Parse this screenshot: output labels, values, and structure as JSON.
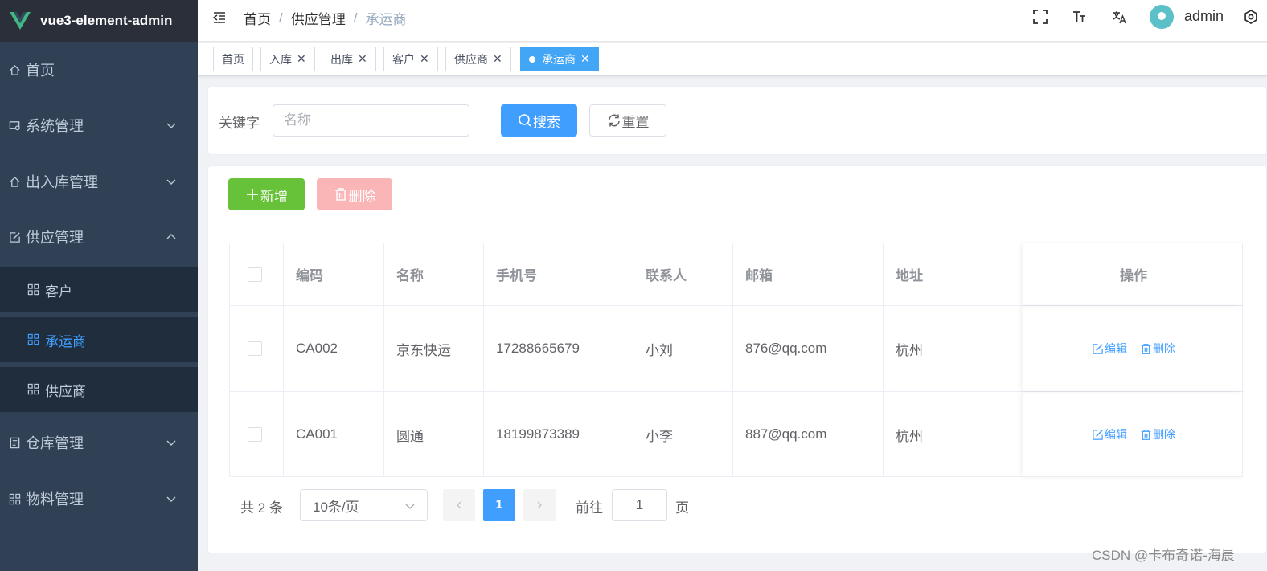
{
  "app": {
    "title": "vue3-element-admin"
  },
  "sidebar": {
    "items": [
      {
        "label": "首页",
        "icon": "home-icon"
      },
      {
        "label": "系统管理",
        "icon": "system-icon"
      },
      {
        "label": "出入库管理",
        "icon": "home-icon"
      },
      {
        "label": "供应管理",
        "icon": "edit-icon"
      },
      {
        "label": "仓库管理",
        "icon": "document-icon"
      },
      {
        "label": "物料管理",
        "icon": "grid-icon"
      }
    ],
    "sub_items": [
      {
        "label": "客户",
        "icon": "grid-icon"
      },
      {
        "label": "承运商",
        "icon": "grid-icon",
        "active": true
      },
      {
        "label": "供应商",
        "icon": "grid-icon"
      }
    ]
  },
  "navbar": {
    "breadcrumb": [
      "首页",
      "供应管理",
      "承运商"
    ],
    "username": "admin"
  },
  "tags": [
    {
      "label": "首页"
    },
    {
      "label": "入库"
    },
    {
      "label": "出库"
    },
    {
      "label": "客户"
    },
    {
      "label": "供应商"
    },
    {
      "label": "承运商",
      "active": true
    }
  ],
  "search": {
    "label": "关键字",
    "placeholder": "名称",
    "search_button": "搜索",
    "reset_button": "重置"
  },
  "toolbar": {
    "add_button": "新增",
    "delete_button": "删除"
  },
  "table": {
    "columns": [
      "编码",
      "名称",
      "手机号",
      "联系人",
      "邮箱",
      "地址",
      "操作"
    ],
    "rows": [
      {
        "code": "CA002",
        "name": "京东快运",
        "phone": "17288665679",
        "contact": "小刘",
        "email": "876@qq.com",
        "address": "杭州"
      },
      {
        "code": "CA001",
        "name": "圆通",
        "phone": "18199873389",
        "contact": "小李",
        "email": "887@qq.com",
        "address": "杭州"
      }
    ],
    "edit_label": "编辑",
    "delete_label": "删除"
  },
  "pagination": {
    "total_text": "共 2 条",
    "page_size": "10条/页",
    "current_page": "1",
    "goto_label": "前往",
    "goto_value": "1",
    "goto_suffix": "页"
  },
  "watermark": "CSDN @卡布奇诺-海晨",
  "colors": {
    "primary": "#409eff",
    "success": "#67c23a",
    "danger_light": "#fab6b6",
    "sidebar_bg": "#304156"
  }
}
